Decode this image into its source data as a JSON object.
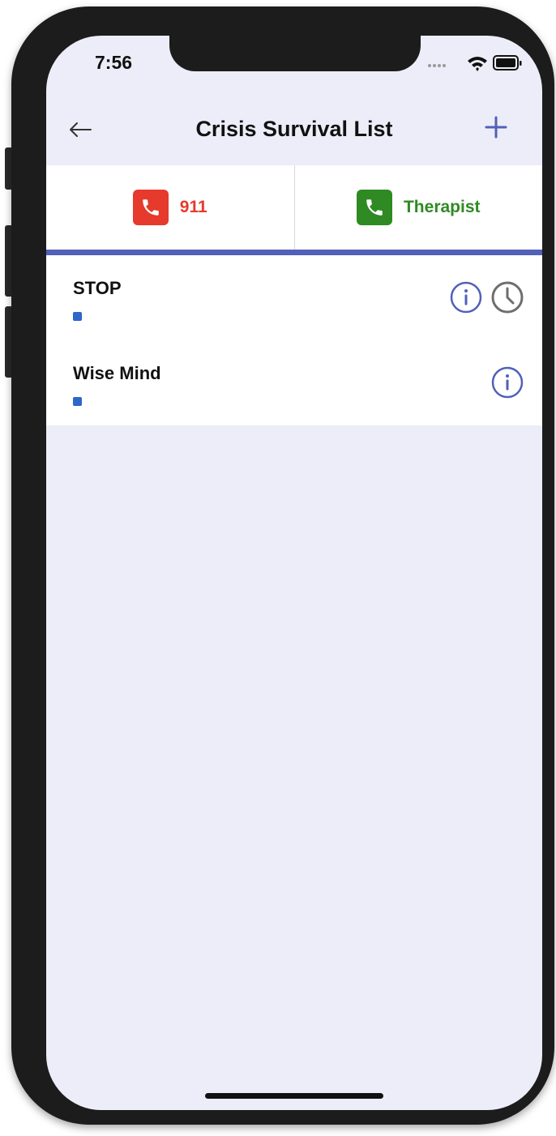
{
  "status_bar": {
    "time": "7:56",
    "icons": [
      "signal-dots-icon",
      "wifi-icon",
      "battery-icon"
    ]
  },
  "header": {
    "title": "Crisis Survival List",
    "back_icon": "arrow-left-icon",
    "add_icon": "plus-icon"
  },
  "contacts": [
    {
      "label": "911",
      "icon": "phone-icon",
      "color": "#e53a2c"
    },
    {
      "label": "Therapist",
      "icon": "phone-icon",
      "color": "#2f8a23"
    }
  ],
  "skills": [
    {
      "title": "STOP",
      "icons": [
        "info-icon",
        "clock-icon"
      ]
    },
    {
      "title": "Wise Mind",
      "icons": [
        "info-icon"
      ]
    }
  ],
  "colors": {
    "accent": "#5160b8",
    "background": "#ecedf8",
    "emergency": "#e53a2c",
    "therapist": "#2f8a23",
    "clock": "#6e6e6e"
  }
}
